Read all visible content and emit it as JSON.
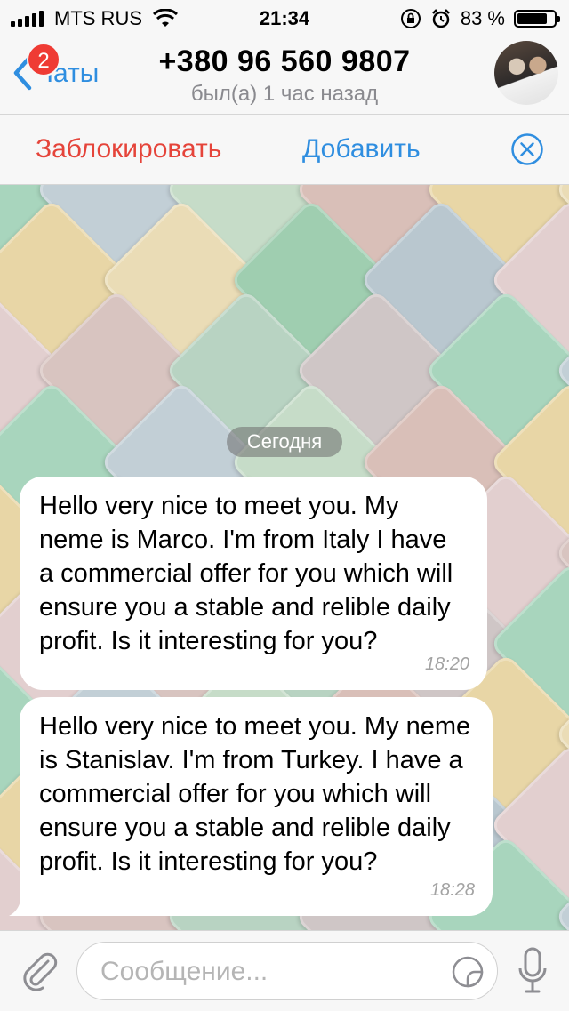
{
  "status_bar": {
    "carrier": "MTS RUS",
    "time": "21:34",
    "battery_percent": "83 %",
    "battery_level": 0.83,
    "icons": [
      "signal-icon",
      "wifi-icon",
      "orientation-lock-icon",
      "alarm-icon",
      "battery-icon"
    ]
  },
  "header": {
    "back_label": "Чаты",
    "unread_badge": "2",
    "title": "+380 96 560 9807",
    "subtitle": "был(а) 1 час назад"
  },
  "action_bar": {
    "block_label": "Заблокировать",
    "add_label": "Добавить"
  },
  "chat": {
    "date_separator": "Сегодня",
    "messages": [
      {
        "text": "Hello very nice to meet you. My neme is Marco. I'm from Italy I have a commercial offer for you which will ensure you a stable and relible daily profit. Is it interesting for you?",
        "time": "18:20"
      },
      {
        "text": "Hello very nice to meet you. My neme is Stanislav. I'm from Turkey. I have a commercial offer for you which will ensure you a stable and relible daily profit. Is it interesting for you?",
        "time": "18:28"
      }
    ]
  },
  "composer": {
    "placeholder": "Сообщение..."
  },
  "colors": {
    "accent": "#2f8ee0",
    "destructive": "#e5443a",
    "badge": "#ef3b34"
  }
}
